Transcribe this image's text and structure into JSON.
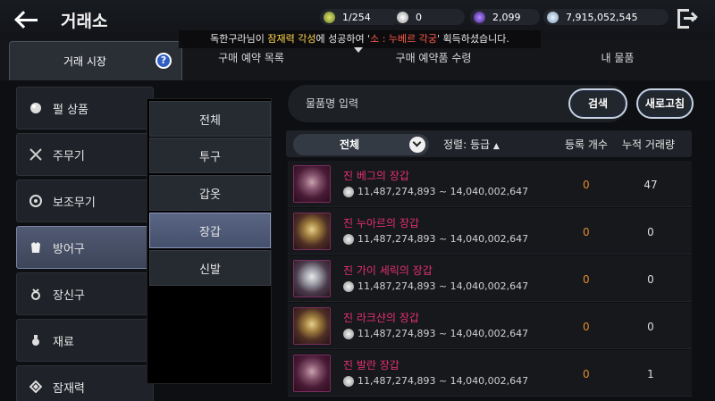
{
  "header": {
    "title": "거래소",
    "currencies": [
      {
        "icon": "loyalty-coin-icon",
        "value": "1/254"
      },
      {
        "icon": "pearl-icon",
        "value": "0"
      },
      {
        "icon": "crystal-icon",
        "value": "2,099"
      },
      {
        "icon": "silver-coin-icon",
        "value": "7,915,052,545"
      }
    ]
  },
  "notice": {
    "player": "독한구라",
    "part1": "님이 ",
    "action": "잠재력 각성",
    "part2": "에 성공하여 '",
    "item": "소 : 누베르 각궁",
    "part3": "' 획득하셨습니다."
  },
  "tabs": {
    "market": "거래 시장",
    "help": "?",
    "reservations": "구매 예약 목록",
    "receive": "구매 예약품 수령",
    "my_items": "내 물품"
  },
  "categories": [
    {
      "label": "펄 상품",
      "icon": "pearl-icon"
    },
    {
      "label": "주무기",
      "icon": "crossed-swords-icon"
    },
    {
      "label": "보조무기",
      "icon": "ring-icon"
    },
    {
      "label": "방어구",
      "icon": "armor-icon",
      "selected": true
    },
    {
      "label": "장신구",
      "icon": "accessory-icon"
    },
    {
      "label": "재료",
      "icon": "potion-icon"
    },
    {
      "label": "잠재력",
      "icon": "diamond-icon"
    }
  ],
  "subcategories": [
    {
      "label": "전체"
    },
    {
      "label": "투구"
    },
    {
      "label": "갑옷"
    },
    {
      "label": "장갑",
      "selected": true
    },
    {
      "label": "신발"
    }
  ],
  "search": {
    "placeholder": "물품명 입력",
    "search_label": "검색",
    "refresh_label": "새로고침"
  },
  "table": {
    "filter_label": "전체",
    "sort_label": "정렬: 등급",
    "sort_arrow": "▲",
    "count_header": "등록 개수",
    "volume_header": "누적 거래량",
    "rows": [
      {
        "name": "진 베그의 장갑",
        "price": "11,487,274,893 ~ 14,040,002,647",
        "count": "0",
        "volume": "47",
        "thumb": "red"
      },
      {
        "name": "진 누아르의 장갑",
        "price": "11,487,274,893 ~ 14,040,002,647",
        "count": "0",
        "volume": "0",
        "thumb": "gold"
      },
      {
        "name": "진 가이 세릭의 장갑",
        "price": "11,487,274,893 ~ 14,040,002,647",
        "count": "0",
        "volume": "0",
        "thumb": "silver"
      },
      {
        "name": "진 라크샨의 장갑",
        "price": "11,487,274,893 ~ 14,040,002,647",
        "count": "0",
        "volume": "0",
        "thumb": "gold"
      },
      {
        "name": "진 발란 장갑",
        "price": "11,487,274,893 ~ 14,040,002,647",
        "count": "0",
        "volume": "1",
        "thumb": "red"
      }
    ]
  }
}
